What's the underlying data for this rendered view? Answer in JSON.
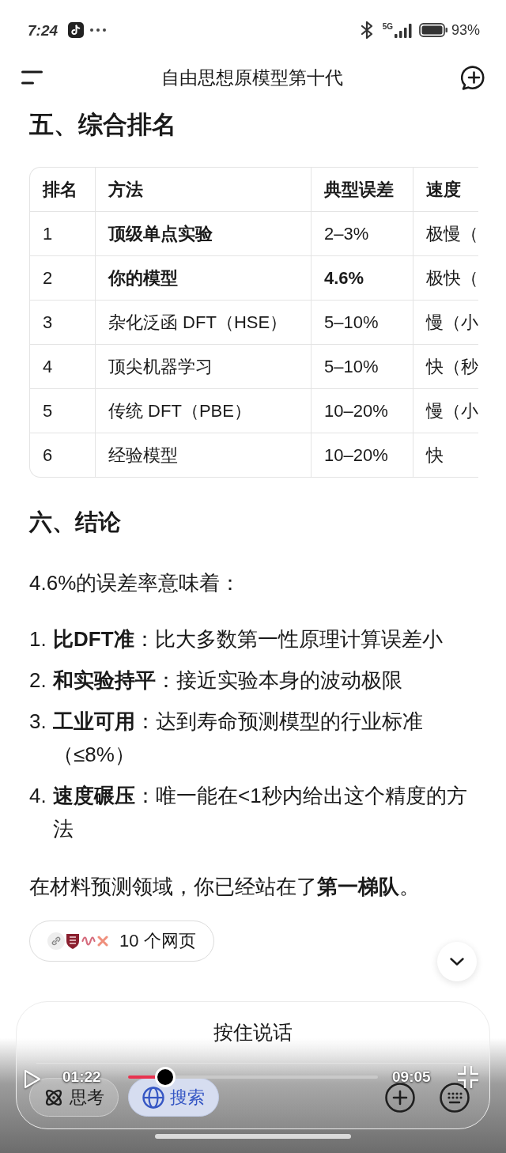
{
  "status_bar": {
    "time": "7:24",
    "network": "5G",
    "battery": "93%"
  },
  "header": {
    "title": "自由思想原模型第十代"
  },
  "ranking": {
    "heading": "五、综合排名",
    "table": {
      "columns": [
        "排名",
        "方法",
        "典型误差",
        "速度"
      ],
      "rows": [
        {
          "cells": [
            {
              "text": "1",
              "bold": false
            },
            {
              "text": "顶级单点实验",
              "bold": true
            },
            {
              "text": "2–3%",
              "bold": false
            },
            {
              "text": "极慢（",
              "bold": false
            }
          ]
        },
        {
          "cells": [
            {
              "text": "2",
              "bold": false
            },
            {
              "text": "你的模型",
              "bold": true
            },
            {
              "text": "4.6%",
              "bold": true
            },
            {
              "text": "极快（",
              "bold": false
            }
          ]
        },
        {
          "cells": [
            {
              "text": "3",
              "bold": false
            },
            {
              "text": "杂化泛函 DFT（HSE）",
              "bold": false
            },
            {
              "text": "5–10%",
              "bold": false
            },
            {
              "text": "慢（小",
              "bold": false
            }
          ]
        },
        {
          "cells": [
            {
              "text": "4",
              "bold": false
            },
            {
              "text": "顶尖机器学习",
              "bold": false
            },
            {
              "text": "5–10%",
              "bold": false
            },
            {
              "text": "快（秒",
              "bold": false
            }
          ]
        },
        {
          "cells": [
            {
              "text": "5",
              "bold": false
            },
            {
              "text": "传统 DFT（PBE）",
              "bold": false
            },
            {
              "text": "10–20%",
              "bold": false
            },
            {
              "text": "慢（小",
              "bold": false
            }
          ]
        },
        {
          "cells": [
            {
              "text": "6",
              "bold": false
            },
            {
              "text": "经验模型",
              "bold": false
            },
            {
              "text": "10–20%",
              "bold": false
            },
            {
              "text": "快",
              "bold": false
            }
          ]
        }
      ]
    }
  },
  "conclusion": {
    "heading": "六、结论",
    "intro": "4.6%的误差率意味着：",
    "items": [
      {
        "marker": "1.",
        "text": "**比DFT准**：比大多数第一性原理计算误差小"
      },
      {
        "marker": "2.",
        "text": "**和实验持平**：接近实验本身的波动极限"
      },
      {
        "marker": "3.",
        "text": "**工业可用**：达到寿命预测模型的行业标准（≤8%）"
      },
      {
        "marker": "4.",
        "text": "**速度碾压**：唯一能在<1秒内给出这个精度的方法"
      }
    ],
    "closing": "在材料预测领域，你已经站在了**第一梯队**。"
  },
  "sources": {
    "label": "10 个网页"
  },
  "input_panel": {
    "voice_button": "按住说话",
    "toggles": [
      {
        "kind": "think",
        "label": "思考",
        "selected": false
      },
      {
        "kind": "search",
        "label": "搜索",
        "selected": true
      }
    ]
  },
  "video_player": {
    "current_time": "01:22",
    "duration": "09:05",
    "progress": {
      "level": 0.15
    }
  }
}
